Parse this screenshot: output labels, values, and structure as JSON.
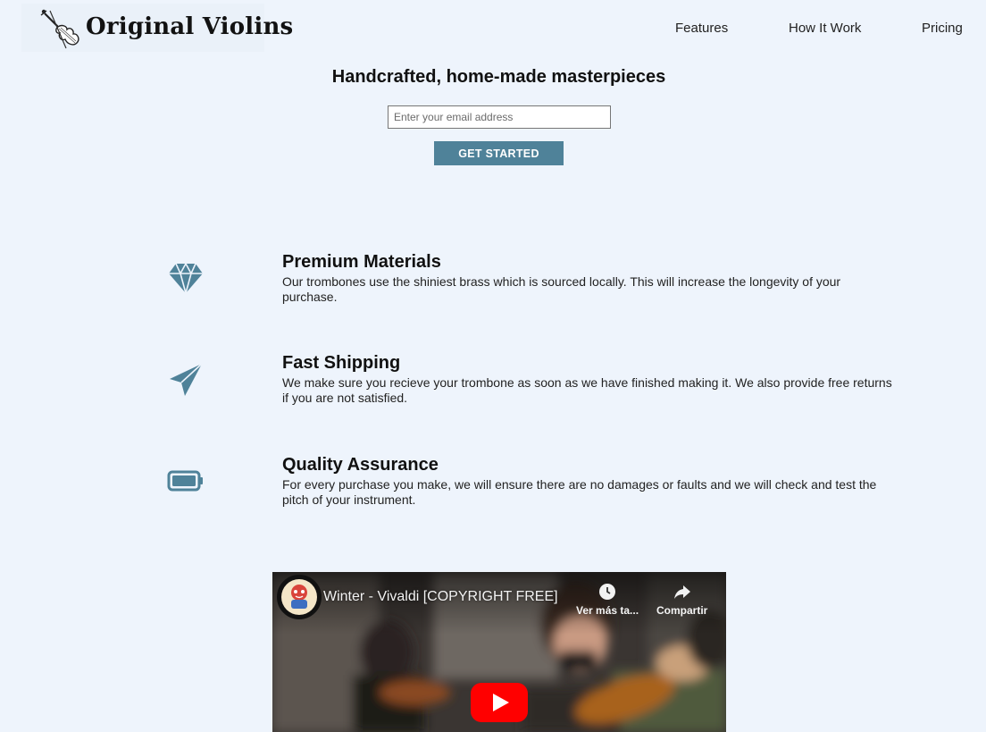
{
  "header": {
    "logo_text": "Original Violins",
    "nav": [
      {
        "label": "Features"
      },
      {
        "label": "How It Work"
      },
      {
        "label": "Pricing"
      }
    ]
  },
  "hero": {
    "title": "Handcrafted, home-made masterpieces",
    "email_placeholder": "Enter your email address",
    "button_label": "GET STARTED"
  },
  "features": [
    {
      "icon": "diamond-icon",
      "title": "Premium Materials",
      "description": "Our trombones use the shiniest brass which is sourced locally. This will increase the longevity of your purchase."
    },
    {
      "icon": "paper-plane-icon",
      "title": "Fast Shipping",
      "description": "We make sure you recieve your trombone as soon as we have finished making it. We also provide free returns if you are not satisfied."
    },
    {
      "icon": "battery-icon",
      "title": "Quality Assurance",
      "description": "For every purchase you make, we will ensure there are no damages or faults and we will check and test the pitch of your instrument."
    }
  ],
  "video": {
    "title": "Winter - Vivaldi [COPYRIGHT FREE]",
    "watch_later_label": "Ver más ta...",
    "share_label": "Compartir"
  },
  "colors": {
    "background": "#eef4fc",
    "accent": "#4f8299",
    "youtube_red": "#ff0000"
  }
}
